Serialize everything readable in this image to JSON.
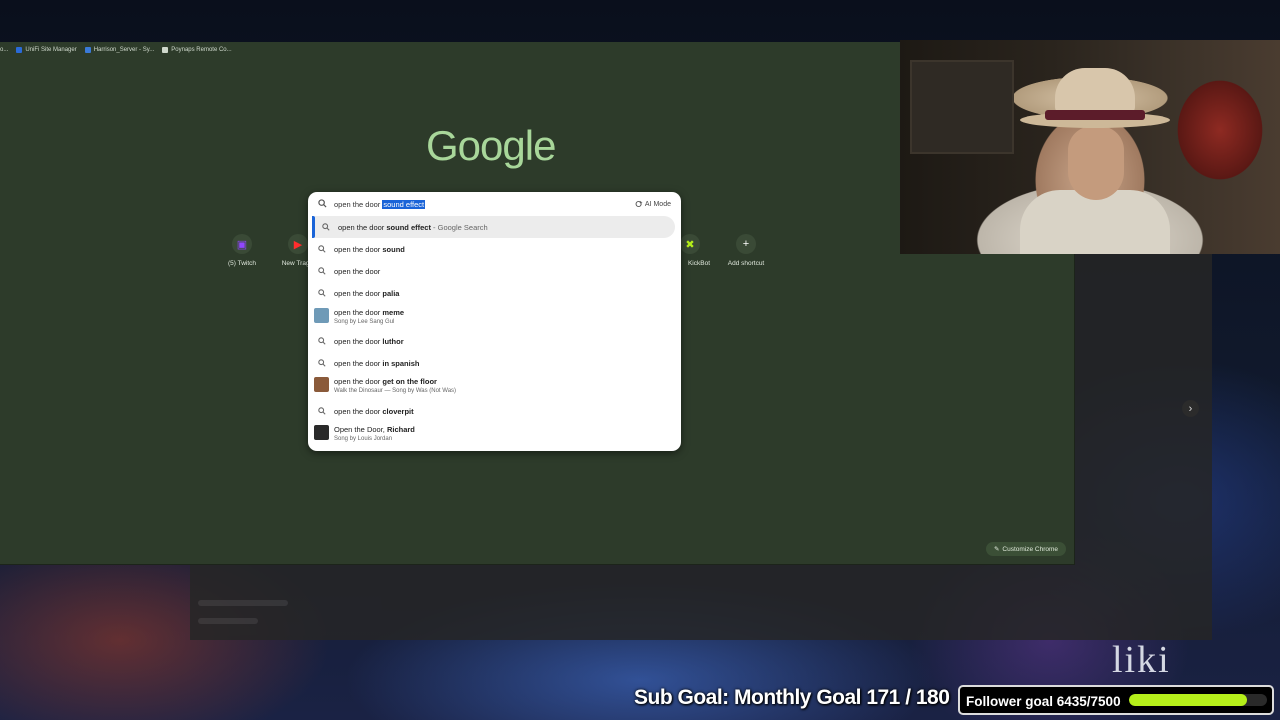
{
  "bookmarks": [
    {
      "label": "o...",
      "color": "#7a8a76"
    },
    {
      "label": "UniFi Site Manager",
      "color": "#2a6ad8"
    },
    {
      "label": "Harrison_Server - Sy...",
      "color": "#3a7ad8"
    },
    {
      "label": "Poynaps Remote Co...",
      "color": "#cfd8cc"
    }
  ],
  "google_logo": "Google",
  "shortcuts": [
    {
      "label": "(5) Twitch",
      "icon": "twitch-icon",
      "glyph": "▣",
      "color": "#9146ff"
    },
    {
      "label": "New Tragic",
      "icon": "youtube-icon",
      "glyph": "▶",
      "color": "#ff2d2d"
    },
    {
      "label": "KickBot",
      "icon": "kickbot-icon",
      "glyph": "✖",
      "color": "#b5ef1a"
    },
    {
      "label": "Add shortcut",
      "icon": "plus-icon",
      "glyph": "+",
      "color": "#ffffff"
    }
  ],
  "omnibox": {
    "typed": "open the door ",
    "selected": "sound effect",
    "ai_mode": "AI Mode"
  },
  "suggestions": [
    {
      "main": "open the door ",
      "bold": "sound effect",
      "suffix": " - Google Search",
      "sub": "",
      "type": "search",
      "highlighted": true
    },
    {
      "main": "open the door ",
      "bold": "sound",
      "suffix": "",
      "sub": "",
      "type": "search"
    },
    {
      "main": "open the door",
      "bold": "",
      "suffix": "",
      "sub": "",
      "type": "search"
    },
    {
      "main": "open the door ",
      "bold": "palia",
      "suffix": "",
      "sub": "",
      "type": "search"
    },
    {
      "main": "open the door ",
      "bold": "meme",
      "suffix": "",
      "sub": "Song by Lee Sang Gul",
      "type": "thumb",
      "thumb_color": "#6f9ab7"
    },
    {
      "main": "open the door ",
      "bold": "luthor",
      "suffix": "",
      "sub": "",
      "type": "search"
    },
    {
      "main": "open the door ",
      "bold": "in spanish",
      "suffix": "",
      "sub": "",
      "type": "search"
    },
    {
      "main": "open the door ",
      "bold": "get on the floor",
      "suffix": "",
      "sub": "Walk the Dinosaur — Song by Was (Not Was)",
      "type": "thumb",
      "thumb_color": "#8a5a3a"
    },
    {
      "main": "open the door ",
      "bold": "cloverpit",
      "suffix": "",
      "sub": "",
      "type": "search"
    },
    {
      "main": "Open the Door, ",
      "bold": "Richard",
      "suffix": "",
      "sub": "Song by Louis Jordan",
      "type": "thumb",
      "thumb_color": "#2a2a2a"
    }
  ],
  "customize_chrome": "Customize Chrome",
  "stream": {
    "liki_logo": "liki",
    "sub_goal": "Sub Goal: Monthly Goal  171 / 180",
    "follower_goal": "Follower goal 6435/7500",
    "follower_progress": 0.858,
    "accent": "#b5ef1a"
  }
}
